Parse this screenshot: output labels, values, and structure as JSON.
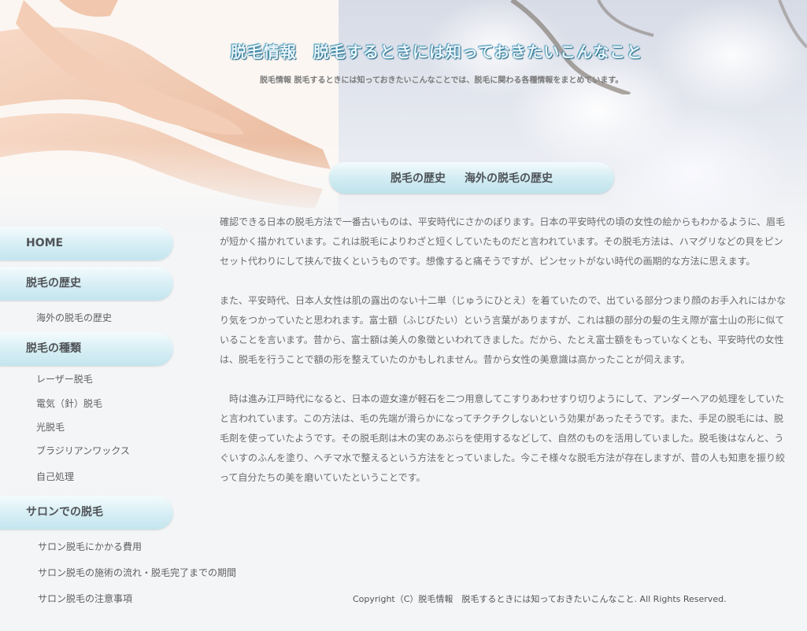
{
  "header": {
    "title": "脱毛情報　脱毛するときには知っておきたいこんなこと",
    "description": "脱毛情報  脱毛するときには知っておきたいこんなことでは、脱毛に関わる各種情報をまとめています。"
  },
  "page": {
    "heading_left": "脱毛の歴史",
    "heading_right": "海外の脱毛の歴史"
  },
  "content": {
    "paragraphs": [
      "確認できる日本の脱毛方法で一番古いものは、平安時代にさかのぼります。日本の平安時代の頃の女性の絵からもわかるように、眉毛が短かく描かれています。これは脱毛によりわざと短くしていたものだと言われています。その脱毛方法は、ハマグリなどの貝をピンセット代わりにして挟んで抜くというものです。想像すると痛そうですが、ピンセットがない時代の画期的な方法に思えます。",
      "また、平安時代、日本人女性は肌の露出のない十二単（じゅうにひとえ）を着ていたので、出ている部分つまり顔のお手入れにはかなり気をつかっていたと思われます。富士額（ふじびたい）という言葉がありますが、これは額の部分の髪の生え際が富士山の形に似ていることを言います。昔から、富士額は美人の象徴といわれてきました。だから、たとえ富士額をもっていなくとも、平安時代の女性は、脱毛を行うことで額の形を整えていたのかもしれません。昔から女性の美意識は高かったことが伺えます。",
      "　時は進み江戸時代になると、日本の遊女達が軽石を二つ用意してこすりあわせすり切りようにして、アンダーヘアの処理をしていたと言われています。この方法は、毛の先端が滑らかになってチクチクしないという効果があったそうです。また、手足の脱毛には、脱毛剤を使っていたようです。その脱毛剤は木の実のあぶらを使用するなどして、自然のものを活用していました。脱毛後はなんと、うぐいすのふんを塗り、ヘチマ水で整えるという方法をとっていました。今こそ様々な脱毛方法が存在しますが、昔の人も知恵を振り絞って自分たちの美を磨いていたということです。"
    ]
  },
  "sidebar": {
    "home": "HOME",
    "history": "脱毛の歴史",
    "history_items": [
      "海外の脱毛の歴史"
    ],
    "types": "脱毛の種類",
    "types_items": [
      "レーザー脱毛",
      "電気（針）脱毛",
      "光脱毛",
      "ブラジリアンワックス",
      "自己処理"
    ],
    "salon": "サロンでの脱毛",
    "salon_items": [
      "サロン脱毛にかかる費用",
      "サロン脱毛の施術の流れ・脱毛完了までの期間",
      "サロン脱毛の注意事項"
    ]
  },
  "footer": {
    "copyright": "Copyright（C）脱毛情報　脱毛するときには知っておきたいこんなこと.  All Rights Reserved."
  },
  "colors": {
    "nav_gradient_top": "#f4fbfd",
    "nav_gradient_bottom": "#c4e5ee",
    "title_glow": "#2c7a9a"
  }
}
